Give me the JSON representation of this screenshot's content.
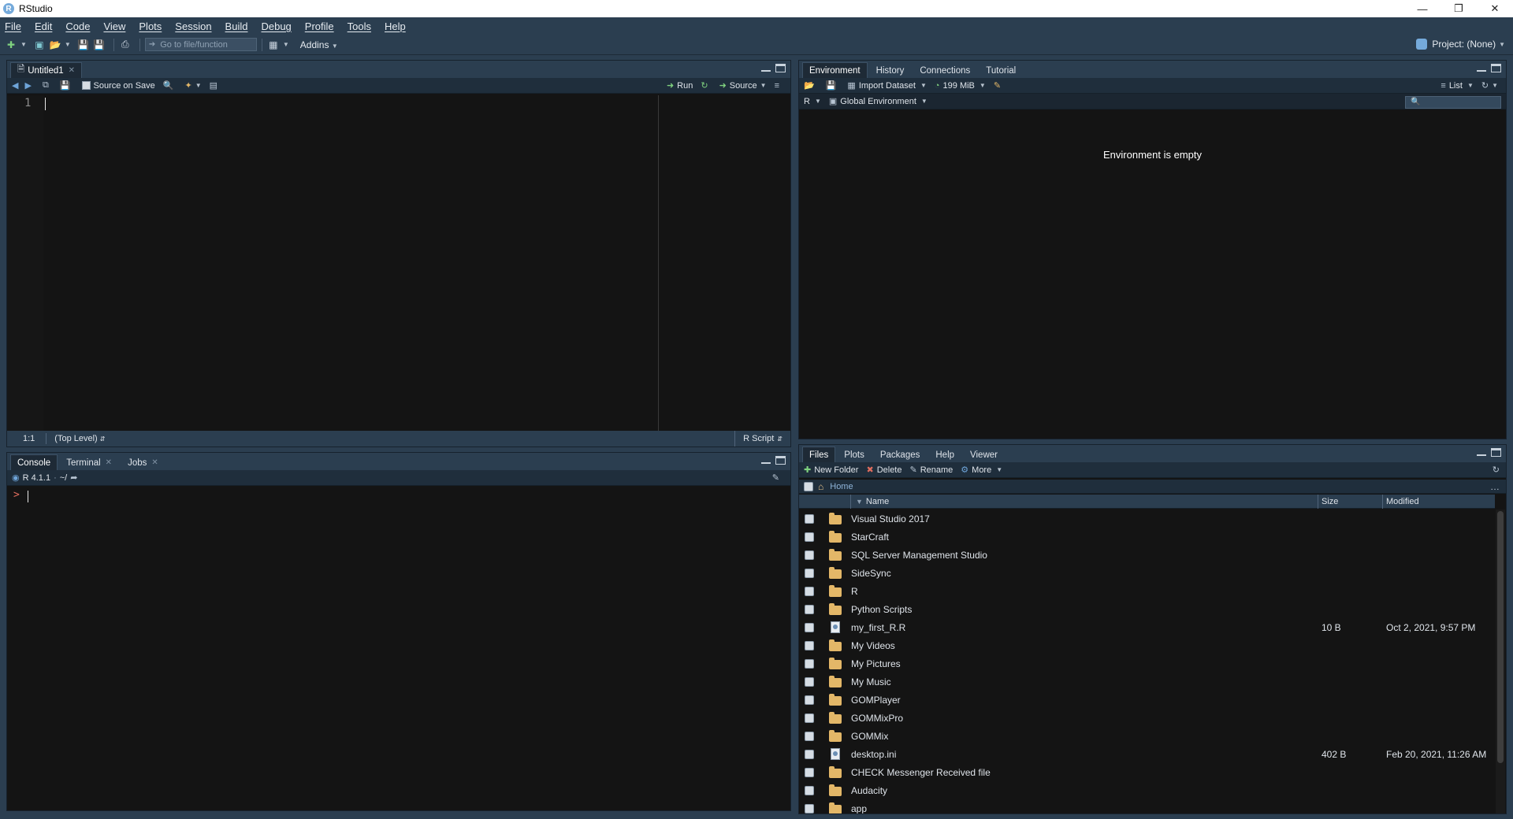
{
  "window": {
    "title": "RStudio",
    "logo_letter": "R"
  },
  "menu": [
    "File",
    "Edit",
    "Code",
    "View",
    "Plots",
    "Session",
    "Build",
    "Debug",
    "Profile",
    "Tools",
    "Help"
  ],
  "toolbar": {
    "goto_placeholder": "Go to file/function",
    "addins": "Addins",
    "project": "Project: (None)"
  },
  "editor": {
    "tab": "Untitled1",
    "source_on_save": "Source on Save",
    "run": "Run",
    "source": "Source",
    "line_number": "1",
    "cursor_pos": "1:1",
    "scope": "(Top Level)",
    "file_type": "R Script"
  },
  "console": {
    "tabs": [
      "Console",
      "Terminal",
      "Jobs"
    ],
    "r_version": "R 4.1.1",
    "path": "~/",
    "prompt": ">"
  },
  "environment": {
    "tabs": [
      "Environment",
      "History",
      "Connections",
      "Tutorial"
    ],
    "import_dataset": "Import Dataset",
    "memory": "199 MiB",
    "view_mode": "List",
    "language": "R",
    "scope": "Global Environment",
    "empty_message": "Environment is empty"
  },
  "files": {
    "tabs": [
      "Files",
      "Plots",
      "Packages",
      "Help",
      "Viewer"
    ],
    "new_folder": "New Folder",
    "delete": "Delete",
    "rename": "Rename",
    "more": "More",
    "breadcrumb": "Home",
    "columns": {
      "name": "Name",
      "size": "Size",
      "modified": "Modified"
    },
    "rows": [
      {
        "type": "folder",
        "name": "Visual Studio 2017",
        "size": "",
        "modified": ""
      },
      {
        "type": "folder",
        "name": "StarCraft",
        "size": "",
        "modified": ""
      },
      {
        "type": "folder",
        "name": "SQL Server Management Studio",
        "size": "",
        "modified": ""
      },
      {
        "type": "folder",
        "name": "SideSync",
        "size": "",
        "modified": ""
      },
      {
        "type": "folder",
        "name": "R",
        "size": "",
        "modified": ""
      },
      {
        "type": "folder",
        "name": "Python Scripts",
        "size": "",
        "modified": ""
      },
      {
        "type": "file",
        "name": "my_first_R.R",
        "size": "10 B",
        "modified": "Oct 2, 2021, 9:57 PM"
      },
      {
        "type": "folder",
        "name": "My Videos",
        "size": "",
        "modified": ""
      },
      {
        "type": "folder",
        "name": "My Pictures",
        "size": "",
        "modified": ""
      },
      {
        "type": "folder",
        "name": "My Music",
        "size": "",
        "modified": ""
      },
      {
        "type": "folder",
        "name": "GOMPlayer",
        "size": "",
        "modified": ""
      },
      {
        "type": "folder",
        "name": "GOMMixPro",
        "size": "",
        "modified": ""
      },
      {
        "type": "folder",
        "name": "GOMMix",
        "size": "",
        "modified": ""
      },
      {
        "type": "file",
        "name": "desktop.ini",
        "size": "402 B",
        "modified": "Feb 20, 2021, 11:26 AM"
      },
      {
        "type": "folder",
        "name": "CHECK Messenger Received file",
        "size": "",
        "modified": ""
      },
      {
        "type": "folder",
        "name": "Audacity",
        "size": "",
        "modified": ""
      },
      {
        "type": "folder",
        "name": "app",
        "size": "",
        "modified": ""
      }
    ]
  }
}
